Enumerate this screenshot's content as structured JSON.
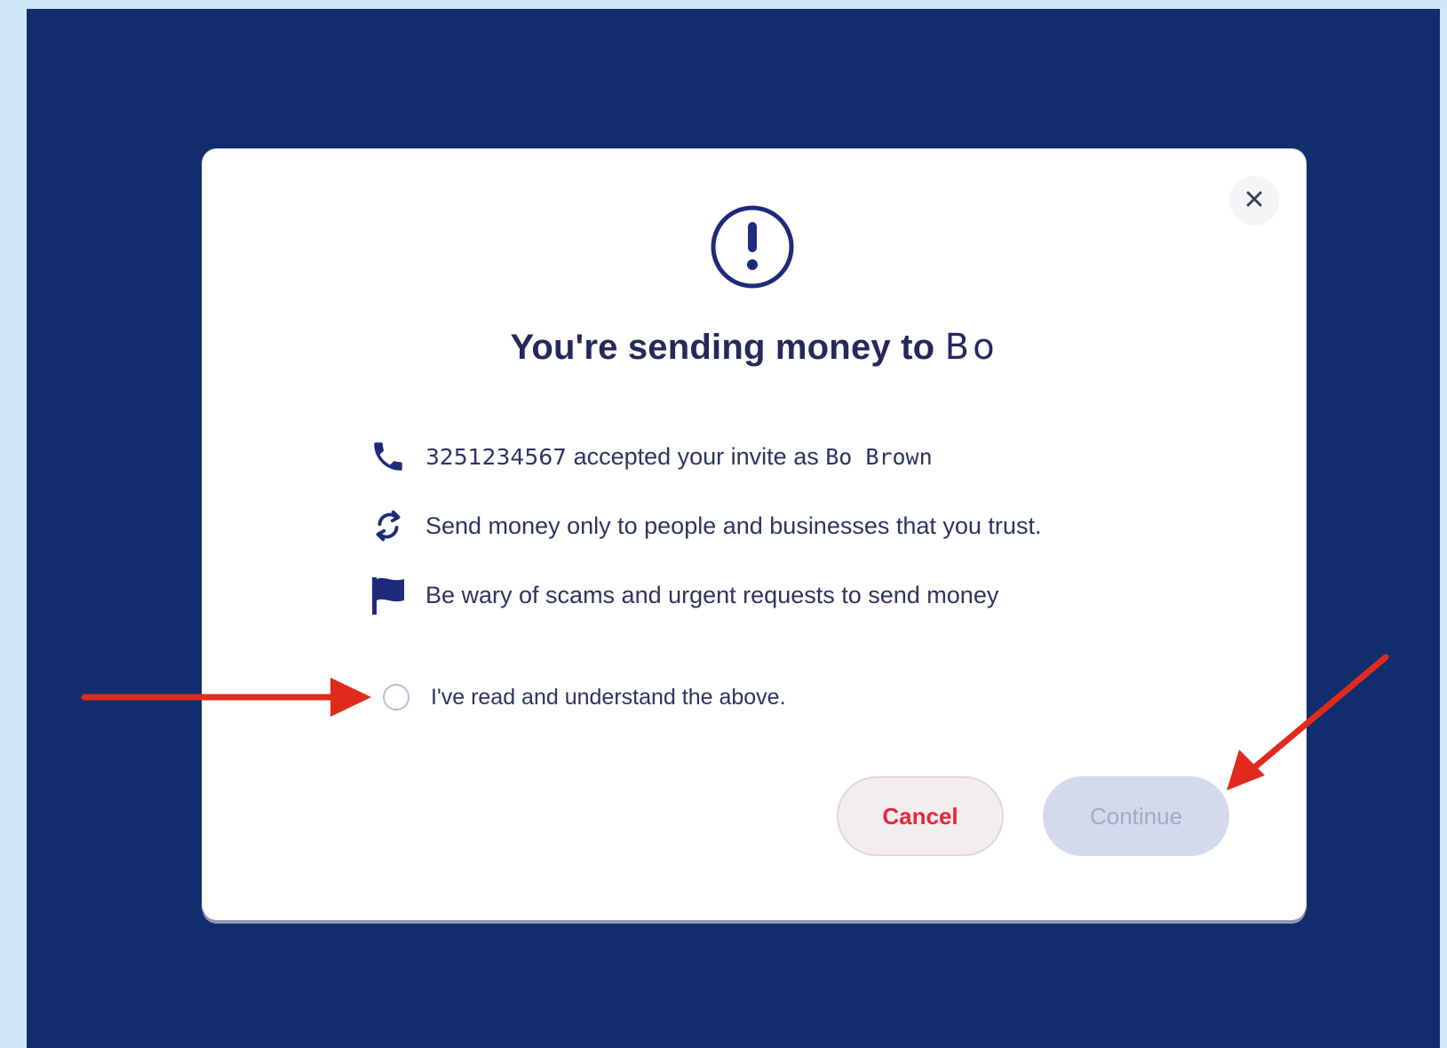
{
  "dialog": {
    "title_prefix": "You're sending money to ",
    "recipient": "Bo",
    "close_icon": "close-icon",
    "alert_icon": "exclamation-circle-icon"
  },
  "info": {
    "phone": {
      "icon": "phone-icon",
      "number": "3251234567",
      "middle": " accepted your invite as ",
      "name": "Bo Brown"
    },
    "trust": {
      "icon": "exchange-icon",
      "text": "Send money only to people and businesses that you trust."
    },
    "scams": {
      "icon": "flag-icon",
      "text": "Be wary of scams and urgent requests to send money"
    }
  },
  "acknowledge": {
    "label": "I've read and understand the above.",
    "checked": false
  },
  "buttons": {
    "cancel": "Cancel",
    "continue": "Continue"
  },
  "colors": {
    "page_background": "#cfe7fb",
    "backdrop": "#112d6d",
    "title": "#23295c",
    "icon": "#1f2a7a",
    "cancel_text": "#e4283a",
    "continue_disabled": "#d4d9eb",
    "annotation_arrow": "#e02b1c"
  }
}
